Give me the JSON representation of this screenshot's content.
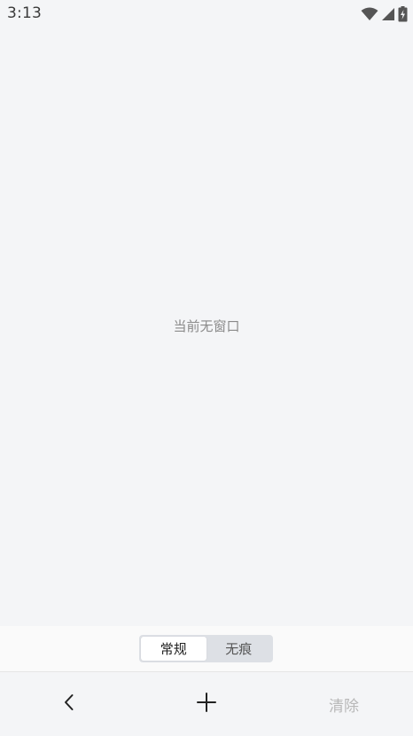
{
  "status_bar": {
    "time": "3:13",
    "icons": [
      "wifi-icon",
      "signal-icon",
      "battery-icon"
    ]
  },
  "main": {
    "empty_message": "当前无窗口"
  },
  "mode_switch": {
    "options": [
      "常规",
      "无痕"
    ],
    "selected": "常规"
  },
  "toolbar": {
    "back_icon": "chevron-left-icon",
    "add_icon": "plus-icon",
    "clear_label": "清除"
  },
  "colors": {
    "background": "#f4f5f7",
    "segment_bg": "#dde0e5",
    "segment_active": "#ffffff",
    "disabled_text": "#b8b8b8"
  }
}
